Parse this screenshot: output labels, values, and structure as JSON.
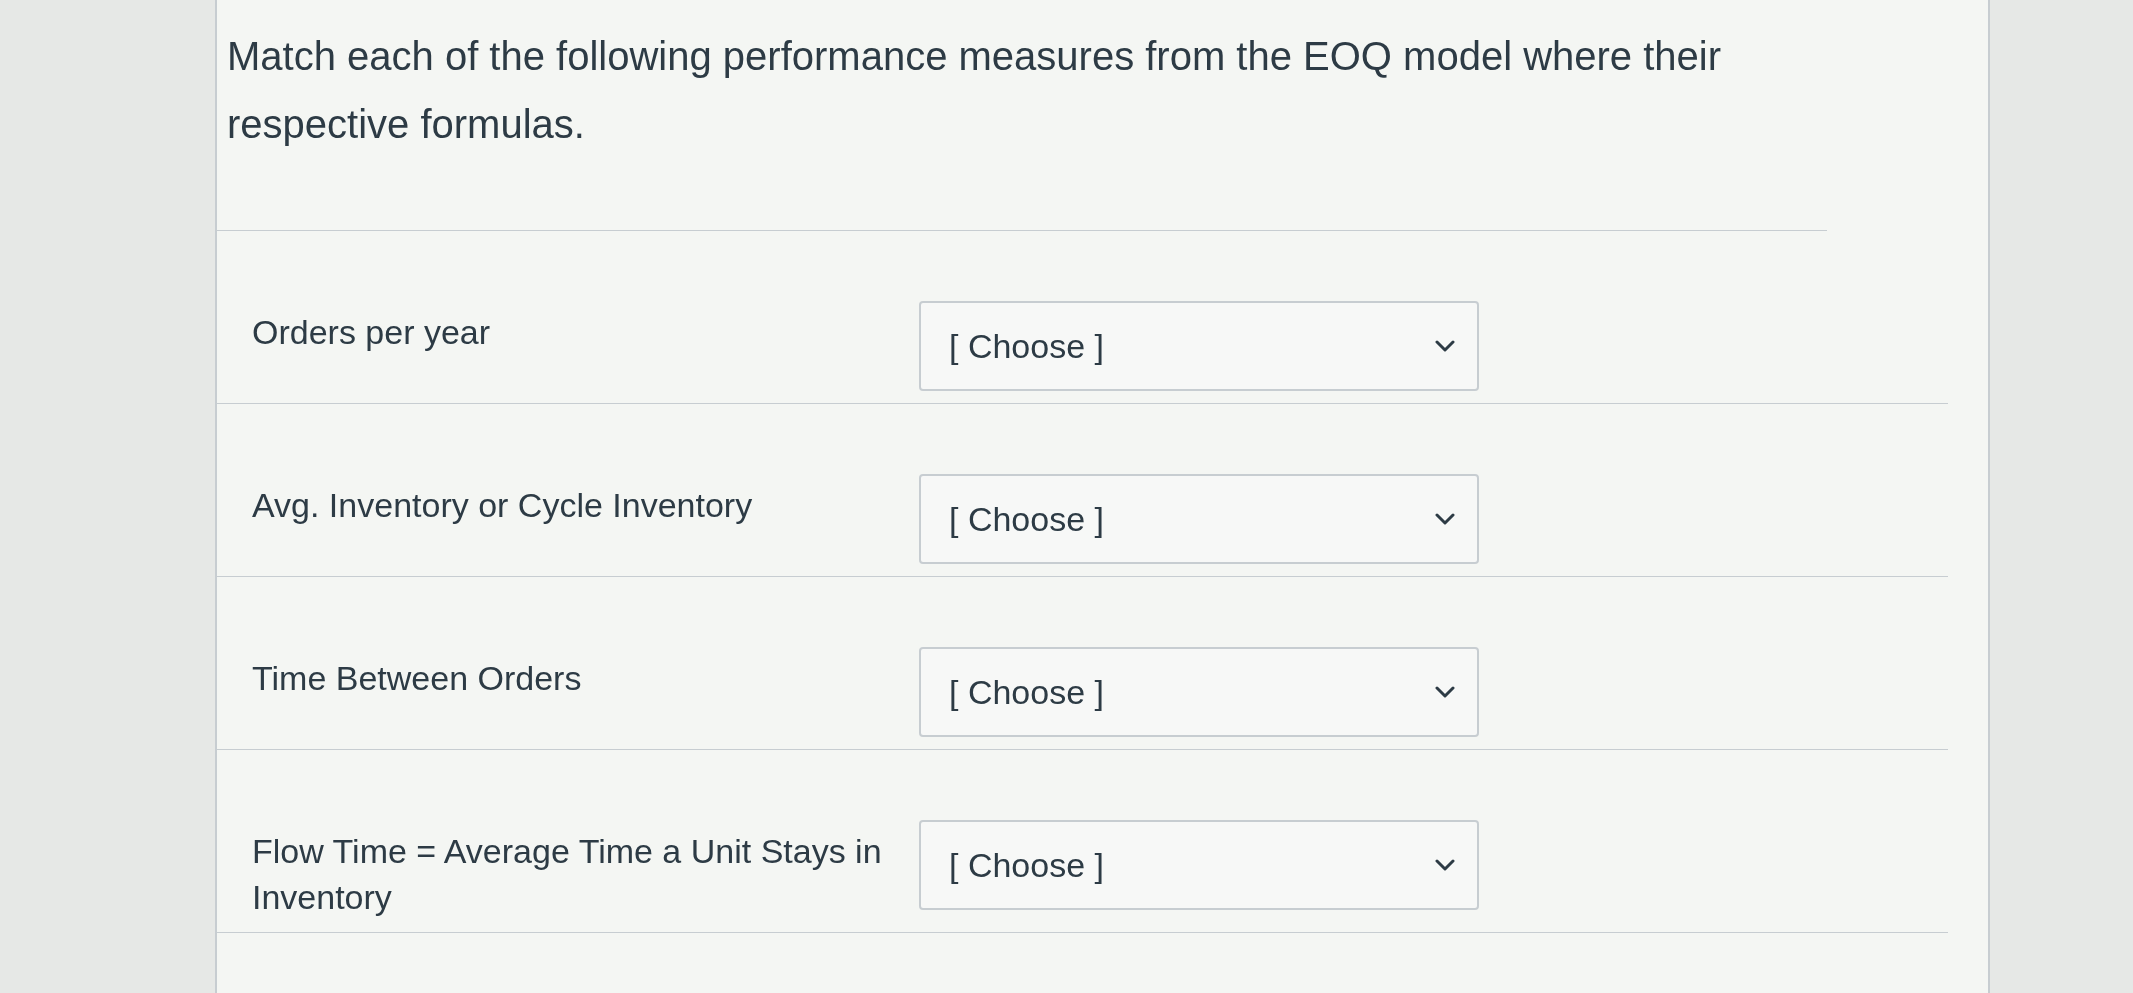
{
  "question": {
    "text": "Match each of the following performance measures from the EOQ model where their respective formulas."
  },
  "rows": [
    {
      "label": "Orders per year",
      "value": "[ Choose ]"
    },
    {
      "label": "Avg. Inventory or Cycle Inventory",
      "value": "[ Choose ]"
    },
    {
      "label": "Time Between Orders",
      "value": "[ Choose ]"
    },
    {
      "label": "Flow Time = Average Time a Unit Stays in Inventory",
      "value": "[ Choose ]"
    }
  ]
}
